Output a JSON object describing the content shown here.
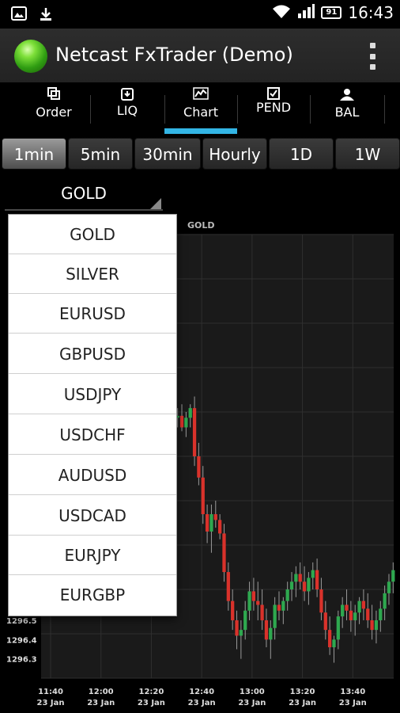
{
  "status_bar": {
    "time": "16:43",
    "battery": "91",
    "icons": [
      "picture-icon",
      "download-icon",
      "wifi-icon",
      "signal-icon",
      "battery-icon"
    ]
  },
  "action_bar": {
    "title": "Netcast FxTrader  (Demo)",
    "icon": "app-orb-icon",
    "menu_icon": "overflow-menu-icon"
  },
  "tabs": [
    {
      "label": "Order",
      "icon": "order-icon",
      "selected": false
    },
    {
      "label": "LIQ",
      "icon": "liq-icon",
      "selected": false
    },
    {
      "label": "Chart",
      "icon": "chart-icon",
      "selected": true
    },
    {
      "label": "PEND",
      "icon": "pend-icon",
      "selected": false
    },
    {
      "label": "BAL",
      "icon": "bal-icon",
      "selected": false
    }
  ],
  "periods": [
    {
      "label": "1min",
      "active": true
    },
    {
      "label": "5min",
      "active": false
    },
    {
      "label": "30min",
      "active": false
    },
    {
      "label": "Hourly",
      "active": false
    },
    {
      "label": "1D",
      "active": false
    },
    {
      "label": "1W",
      "active": false
    }
  ],
  "instrument": {
    "selected": "GOLD",
    "options": [
      "GOLD",
      "SILVER",
      "EURUSD",
      "GBPUSD",
      "USDJPY",
      "USDCHF",
      "AUDUSD",
      "USDCAD",
      "EURJPY",
      "EURGBP"
    ]
  },
  "colors": {
    "accent": "#33b5e5",
    "up_candle": "#2ea84f",
    "down_candle": "#d9322b",
    "chart_bg": "#1a1a1a"
  },
  "chart_data": {
    "type": "candlestick",
    "title": "GOLD",
    "y_ticks": [
      "1296.5",
      "1296.4",
      "1296.3"
    ],
    "ylim": [
      1296.2,
      1298.5
    ],
    "x_ticks": [
      {
        "time": "11:40",
        "date": "23 Jan"
      },
      {
        "time": "12:00",
        "date": "23 Jan"
      },
      {
        "time": "12:20",
        "date": "23 Jan"
      },
      {
        "time": "12:40",
        "date": "23 Jan"
      },
      {
        "time": "13:00",
        "date": "23 Jan"
      },
      {
        "time": "13:20",
        "date": "23 Jan"
      },
      {
        "time": "13:40",
        "date": "23 Jan"
      }
    ],
    "grid": true,
    "candles": [
      [
        1297.55,
        1297.6,
        1297.5,
        1297.56
      ],
      [
        1297.56,
        1297.62,
        1297.48,
        1297.5
      ],
      [
        1297.5,
        1297.58,
        1297.45,
        1297.55
      ],
      [
        1297.55,
        1297.62,
        1297.5,
        1297.6
      ],
      [
        1297.6,
        1297.66,
        1297.3,
        1297.35
      ],
      [
        1297.35,
        1297.42,
        1297.2,
        1297.24
      ],
      [
        1297.24,
        1297.3,
        1297.0,
        1297.05
      ],
      [
        1297.05,
        1297.1,
        1296.9,
        1296.96
      ],
      [
        1296.96,
        1297.1,
        1296.85,
        1297.05
      ],
      [
        1297.05,
        1297.12,
        1296.98,
        1297.02
      ],
      [
        1297.02,
        1297.05,
        1296.92,
        1296.95
      ],
      [
        1296.95,
        1297.0,
        1296.7,
        1296.75
      ],
      [
        1296.75,
        1296.8,
        1296.55,
        1296.6
      ],
      [
        1296.6,
        1296.66,
        1296.45,
        1296.5
      ],
      [
        1296.5,
        1296.55,
        1296.35,
        1296.42
      ],
      [
        1296.42,
        1296.5,
        1296.3,
        1296.45
      ],
      [
        1296.45,
        1296.6,
        1296.4,
        1296.55
      ],
      [
        1296.55,
        1296.7,
        1296.5,
        1296.65
      ],
      [
        1296.65,
        1296.72,
        1296.55,
        1296.6
      ],
      [
        1296.6,
        1296.7,
        1296.5,
        1296.58
      ],
      [
        1296.58,
        1296.66,
        1296.45,
        1296.5
      ],
      [
        1296.5,
        1296.56,
        1296.36,
        1296.4
      ],
      [
        1296.4,
        1296.5,
        1296.3,
        1296.46
      ],
      [
        1296.46,
        1296.62,
        1296.4,
        1296.58
      ],
      [
        1296.58,
        1296.65,
        1296.5,
        1296.55
      ],
      [
        1296.55,
        1296.62,
        1296.48,
        1296.6
      ],
      [
        1296.6,
        1296.7,
        1296.55,
        1296.66
      ],
      [
        1296.66,
        1296.75,
        1296.6,
        1296.7
      ],
      [
        1296.7,
        1296.78,
        1296.62,
        1296.74
      ],
      [
        1296.74,
        1296.8,
        1296.66,
        1296.7
      ],
      [
        1296.7,
        1296.78,
        1296.6,
        1296.65
      ],
      [
        1296.65,
        1296.75,
        1296.58,
        1296.72
      ],
      [
        1296.72,
        1296.8,
        1296.66,
        1296.76
      ],
      [
        1296.76,
        1296.82,
        1296.62,
        1296.66
      ],
      [
        1296.66,
        1296.72,
        1296.5,
        1296.54
      ],
      [
        1296.54,
        1296.6,
        1296.4,
        1296.45
      ],
      [
        1296.45,
        1296.52,
        1296.32,
        1296.36
      ],
      [
        1296.36,
        1296.42,
        1296.28,
        1296.4
      ],
      [
        1296.4,
        1296.55,
        1296.35,
        1296.52
      ],
      [
        1296.52,
        1296.62,
        1296.46,
        1296.58
      ],
      [
        1296.58,
        1296.66,
        1296.5,
        1296.55
      ],
      [
        1296.55,
        1296.6,
        1296.44,
        1296.5
      ],
      [
        1296.5,
        1296.58,
        1296.42,
        1296.54
      ],
      [
        1296.54,
        1296.62,
        1296.48,
        1296.6
      ],
      [
        1296.6,
        1296.66,
        1296.5,
        1296.56
      ],
      [
        1296.56,
        1296.64,
        1296.46,
        1296.5
      ],
      [
        1296.5,
        1296.58,
        1296.4,
        1296.45
      ],
      [
        1296.45,
        1296.55,
        1296.38,
        1296.5
      ],
      [
        1296.5,
        1296.6,
        1296.44,
        1296.56
      ],
      [
        1296.56,
        1296.68,
        1296.5,
        1296.64
      ],
      [
        1296.64,
        1296.74,
        1296.58,
        1296.7
      ],
      [
        1296.7,
        1296.8,
        1296.64,
        1296.76
      ]
    ]
  }
}
